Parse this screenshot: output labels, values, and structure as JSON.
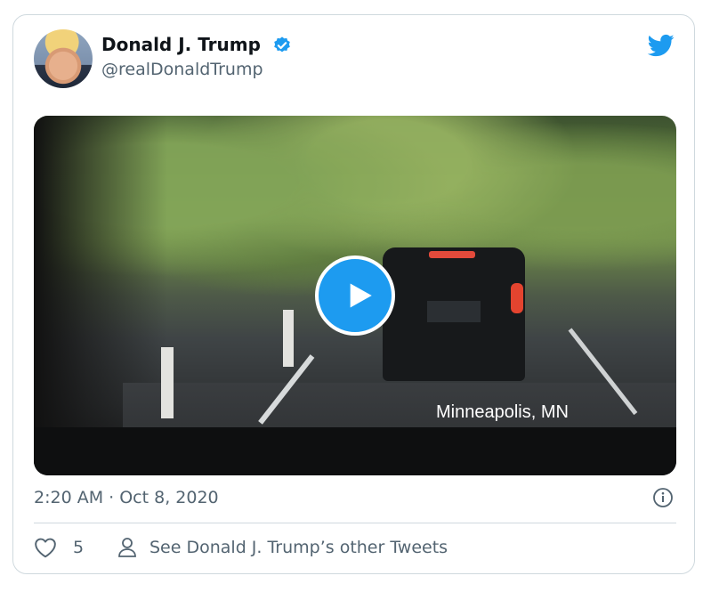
{
  "tweet": {
    "author_name": "Donald J. Trump",
    "handle": "@realDonaldTrump",
    "timestamp": "2:20 AM · Oct 8, 2020",
    "media_caption": "Minneapolis, MN",
    "like_count": "5",
    "other_tweets_label": "See Donald J. Trump’s other Tweets"
  },
  "icons": {
    "verified": "verified-badge-icon",
    "brand": "twitter-bird-icon",
    "play": "play-icon",
    "info": "info-icon",
    "like": "heart-icon",
    "profile": "person-icon"
  },
  "colors": {
    "accent": "#1d9bf0",
    "text_primary": "#0f1419",
    "text_secondary": "#536471",
    "border": "#cfd9de"
  }
}
